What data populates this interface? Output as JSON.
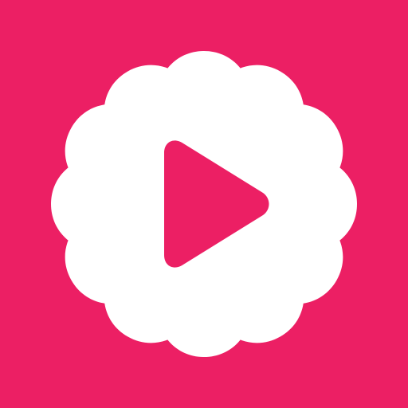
{
  "icon": {
    "name": "flower-play-icon",
    "colors": {
      "background": "#EC1F64",
      "flower": "#FFFFFF",
      "play": "#EC1F64"
    }
  }
}
